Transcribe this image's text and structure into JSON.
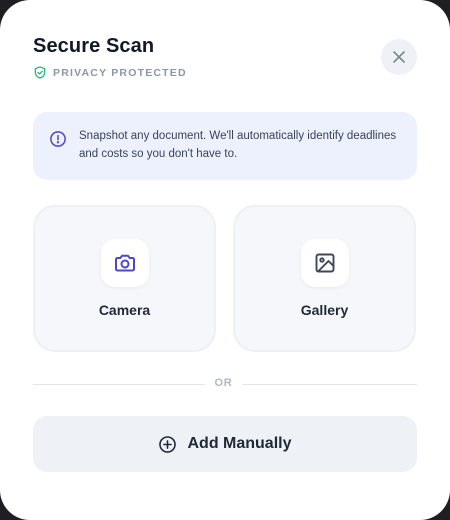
{
  "modal": {
    "title": "Secure Scan",
    "privacy_label": "PRIVACY PROTECTED",
    "close_icon": "close-icon"
  },
  "info": {
    "icon": "info-circle-icon",
    "text": "Snapshot any document. We'll automatically identify deadlines and costs so you don't have to."
  },
  "sources": {
    "camera": {
      "label": "Camera",
      "icon": "camera-icon"
    },
    "gallery": {
      "label": "Gallery",
      "icon": "image-icon"
    }
  },
  "divider": {
    "label": "OR"
  },
  "manual": {
    "label": "Add Manually",
    "icon": "plus-circle-icon"
  },
  "colors": {
    "accent": "#4f46c8",
    "shield": "#22b573",
    "info_bg": "#edf1fd",
    "card_bg": "#f6f7fa",
    "button_bg": "#eef1f6",
    "title": "#111827"
  }
}
